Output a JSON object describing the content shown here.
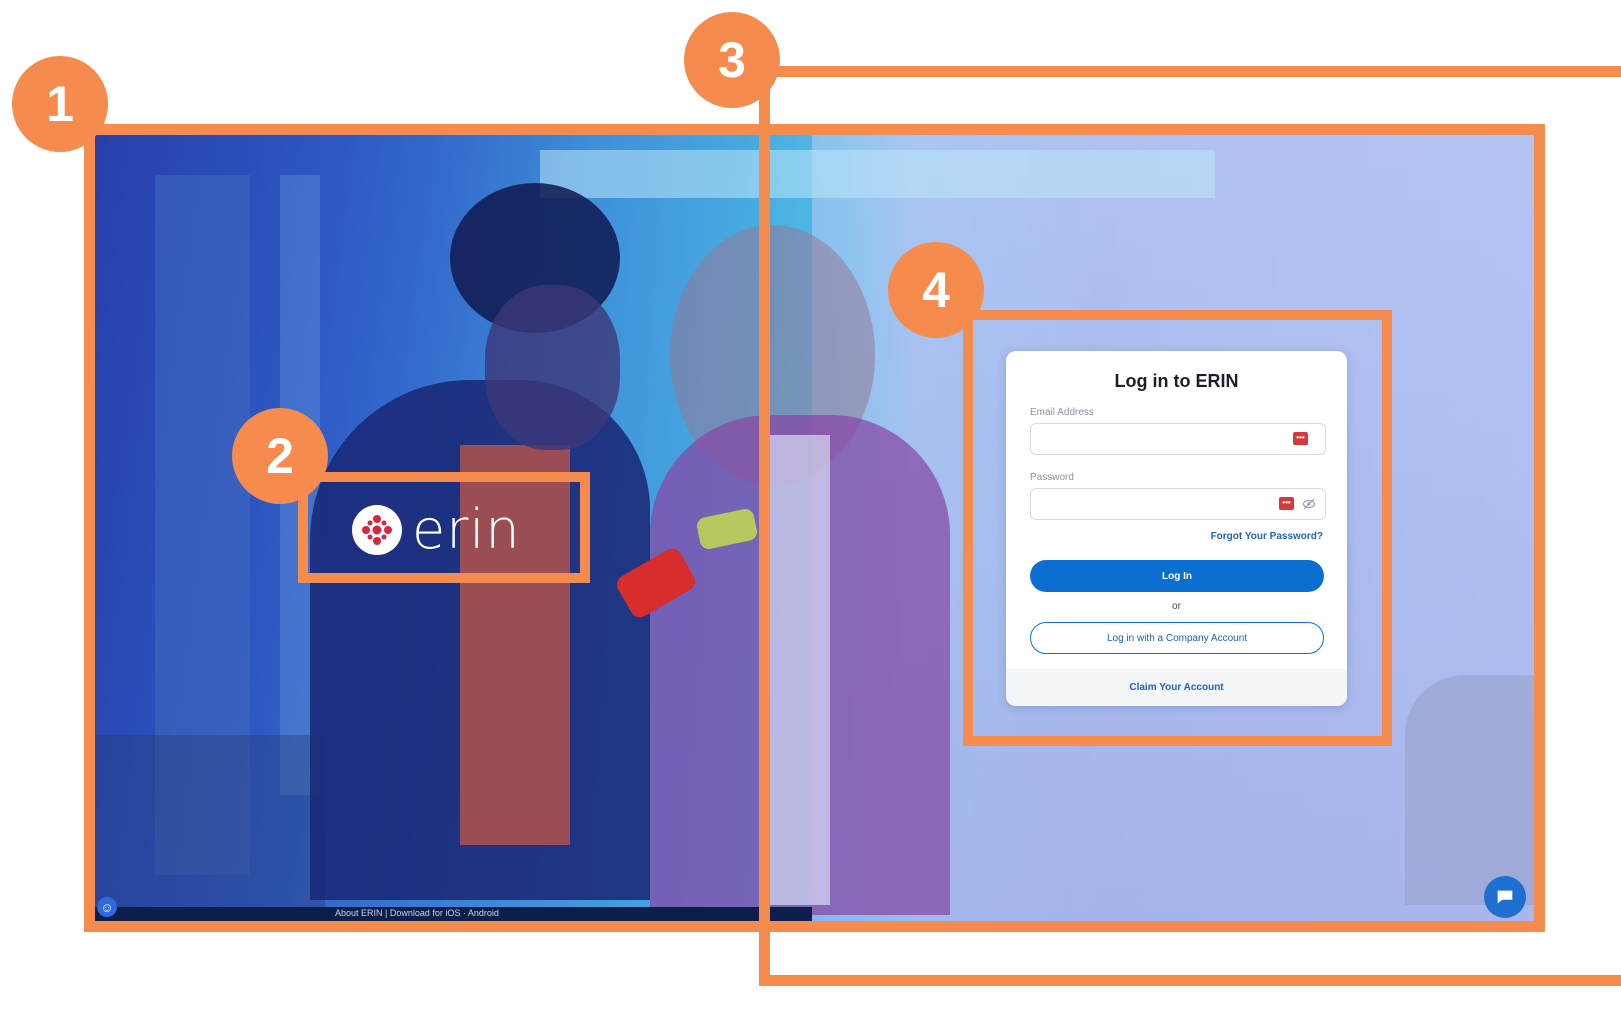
{
  "annotations": {
    "badge_1": "1",
    "badge_2": "2",
    "badge_3": "3",
    "badge_4": "4"
  },
  "brand": {
    "logo_text": "erin"
  },
  "footer": {
    "links_text": "About ERIN  |  Download for iOS · Android"
  },
  "login": {
    "title": "Log in to ERIN",
    "email_label": "Email Address",
    "email_value": "",
    "password_label": "Password",
    "password_value": "",
    "forgot_password": "Forgot Your Password?",
    "login_button": "Log In",
    "or": "or",
    "company_button": "Log in with a Company Account",
    "claim_account": "Claim Your Account"
  },
  "icons": {
    "password_manager": "password-manager-icon",
    "eye": "eye-slash-icon",
    "accessibility": "accessibility-icon",
    "chat": "chat-bubble-icon"
  },
  "colors": {
    "annotation": "#F58B4C",
    "primary": "#0b6fd1",
    "link": "#1d64c4",
    "password_manager": "#d43a3a"
  }
}
